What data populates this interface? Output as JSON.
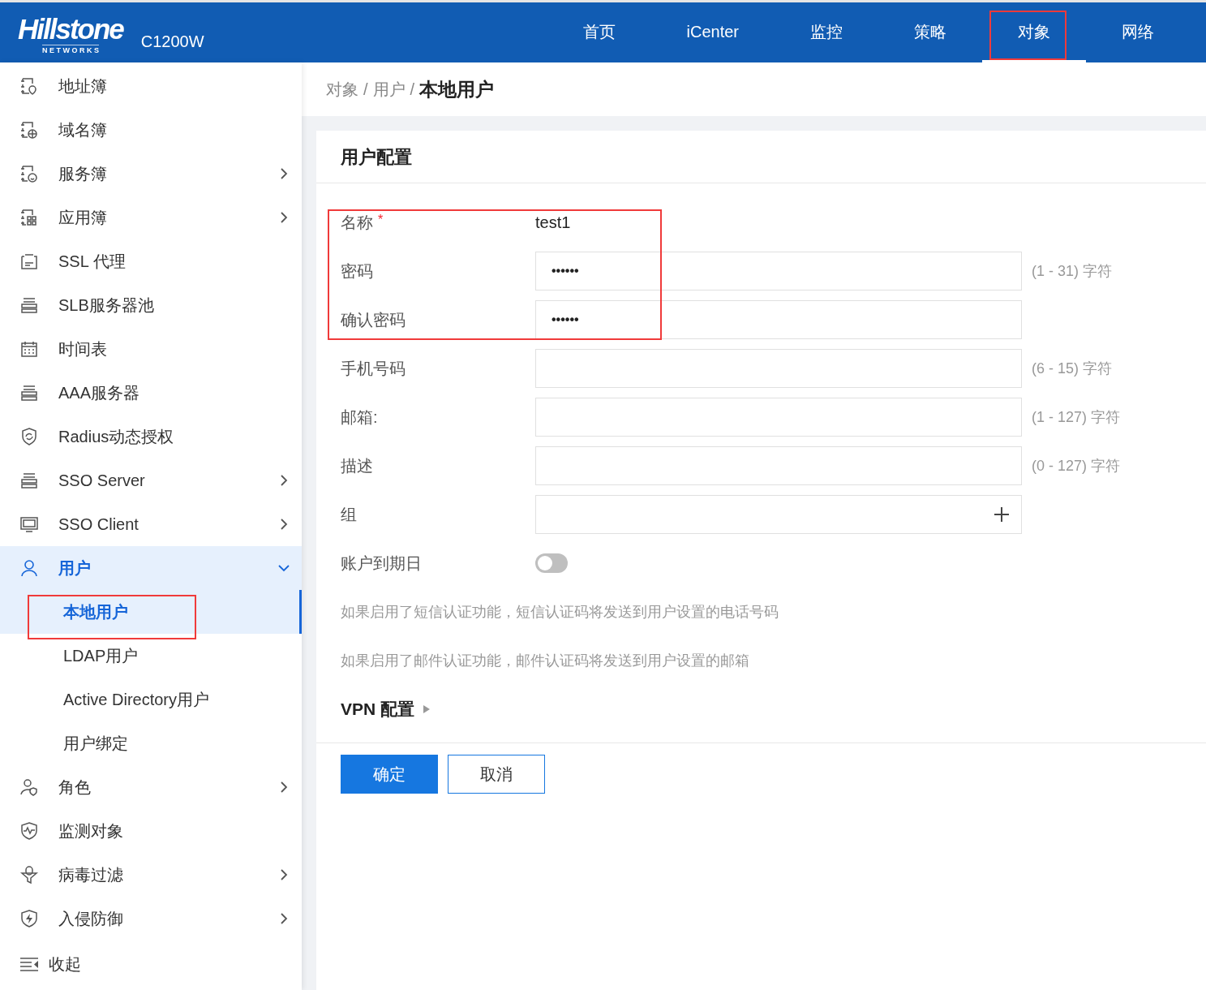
{
  "header": {
    "logo": "Hillstone",
    "logo_sub": "N E T W O R K S",
    "model": "C1200W"
  },
  "nav": [
    {
      "label": "首页",
      "selected": false
    },
    {
      "label": "iCenter",
      "selected": false
    },
    {
      "label": "监控",
      "selected": false
    },
    {
      "label": "策略",
      "selected": false
    },
    {
      "label": "对象",
      "selected": true
    },
    {
      "label": "网络",
      "selected": false
    }
  ],
  "sidebar": {
    "items": [
      {
        "label": "地址簿",
        "submenu": false,
        "expanded": false
      },
      {
        "label": "域名簿",
        "submenu": false,
        "expanded": false
      },
      {
        "label": "服务簿",
        "submenu": true,
        "expanded": false
      },
      {
        "label": "应用簿",
        "submenu": true,
        "expanded": false
      },
      {
        "label": "SSL 代理",
        "submenu": false,
        "expanded": false
      },
      {
        "label": "SLB服务器池",
        "submenu": false,
        "expanded": false
      },
      {
        "label": "时间表",
        "submenu": false,
        "expanded": false
      },
      {
        "label": "AAA服务器",
        "submenu": false,
        "expanded": false
      },
      {
        "label": "Radius动态授权",
        "submenu": false,
        "expanded": false
      },
      {
        "label": "SSO Server",
        "submenu": true,
        "expanded": false
      },
      {
        "label": "SSO Client",
        "submenu": true,
        "expanded": false
      },
      {
        "label": "用户",
        "submenu": true,
        "expanded": true,
        "children": [
          {
            "label": "本地用户",
            "selected": true
          },
          {
            "label": "LDAP用户",
            "selected": false
          },
          {
            "label": "Active Directory用户",
            "selected": false
          },
          {
            "label": "用户绑定",
            "selected": false
          }
        ]
      },
      {
        "label": "角色",
        "submenu": true,
        "expanded": false
      },
      {
        "label": "监测对象",
        "submenu": false,
        "expanded": false
      },
      {
        "label": "病毒过滤",
        "submenu": true,
        "expanded": false
      },
      {
        "label": "入侵防御",
        "submenu": true,
        "expanded": false
      }
    ],
    "collapse": "收起"
  },
  "breadcrumb": [
    {
      "text": "对象",
      "kind": "link"
    },
    {
      "text": "/",
      "kind": "sep"
    },
    {
      "text": "用户",
      "kind": "link"
    },
    {
      "text": "/",
      "kind": "sep"
    },
    {
      "text": "本地用户",
      "kind": "current"
    }
  ],
  "form": {
    "title": "用户配置",
    "fields": [
      {
        "kind": "static",
        "label": "名称",
        "required_mark": "*",
        "value": "test1"
      },
      {
        "kind": "input",
        "label": "密码",
        "value": "••••••",
        "hint": "(1 - 31) 字符"
      },
      {
        "kind": "input",
        "label": "确认密码",
        "value": "••••••"
      },
      {
        "kind": "input",
        "label": "手机号码",
        "hint": "(6 - 15) 字符"
      },
      {
        "kind": "input",
        "label": "邮箱:",
        "hint": "(1 - 127) 字符"
      },
      {
        "kind": "input",
        "label": "描述",
        "hint": "(0 - 127) 字符"
      },
      {
        "kind": "add",
        "label": "组"
      },
      {
        "kind": "toggle",
        "label": "账户到期日",
        "on": false
      }
    ],
    "notes": [
      "如果启用了短信认证功能，短信认证码将发送到用户设置的电话号码",
      "如果启用了邮件认证功能，邮件认证码将发送到用户设置的邮箱"
    ],
    "vpn": {
      "label": "VPN 配置",
      "expanded": false
    },
    "buttons": [
      {
        "label": "确定",
        "kind": "primary"
      },
      {
        "label": "取消",
        "kind": "secondary"
      }
    ]
  }
}
